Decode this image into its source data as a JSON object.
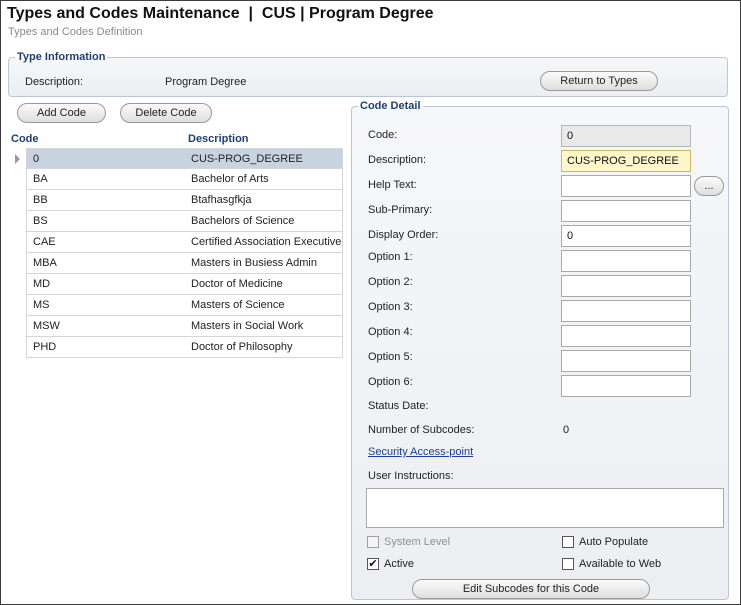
{
  "header": {
    "title": "Types and Codes Maintenance  |  CUS | Program Degree",
    "subtitle": "Types and Codes Definition"
  },
  "type_info": {
    "legend": "Type Information",
    "description_label": "Description:",
    "description_value": "Program Degree",
    "return_button": "Return to Types"
  },
  "code_list": {
    "add_button": "Add Code",
    "delete_button": "Delete Code",
    "columns": [
      "Code",
      "Description"
    ],
    "rows": [
      {
        "code": "0",
        "description": "CUS-PROG_DEGREE"
      },
      {
        "code": "BA",
        "description": "Bachelor of Arts"
      },
      {
        "code": "BB",
        "description": "Btafhasgfkja"
      },
      {
        "code": "BS",
        "description": "Bachelors of Science"
      },
      {
        "code": "CAE",
        "description": "Certified Association Executive"
      },
      {
        "code": "MBA",
        "description": "Masters in Busiess Admin"
      },
      {
        "code": "MD",
        "description": "Doctor of Medicine"
      },
      {
        "code": "MS",
        "description": "Masters of Science"
      },
      {
        "code": "MSW",
        "description": "Masters in Social Work"
      },
      {
        "code": "PHD",
        "description": "Doctor of Philosophy"
      }
    ],
    "selected_index": 0
  },
  "code_detail": {
    "legend": "Code Detail",
    "code_label": "Code:",
    "code_value": "0",
    "description_label": "Description:",
    "description_value": "CUS-PROG_DEGREE",
    "help_text_label": "Help Text:",
    "help_text_value": "",
    "help_button": "...",
    "sub_primary_label": "Sub-Primary:",
    "sub_primary_value": "",
    "display_order_label": "Display Order:",
    "display_order_value": "0",
    "option1_label": "Option 1:",
    "option2_label": "Option 2:",
    "option3_label": "Option 3:",
    "option4_label": "Option 4:",
    "option5_label": "Option 5:",
    "option6_label": "Option 6:",
    "status_date_label": "Status Date:",
    "subcodes_label": "Number of Subcodes:",
    "subcodes_value": "0",
    "security_link": "Security Access-point",
    "user_instructions_label": "User Instructions:",
    "system_level_label": "System Level",
    "system_level_checked": false,
    "auto_populate_label": "Auto Populate",
    "auto_populate_checked": false,
    "active_label": "Active",
    "active_checked": true,
    "available_web_label": "Available to Web",
    "available_web_checked": false,
    "check_mark": "✔",
    "edit_subcodes_button": "Edit Subcodes for this Code"
  }
}
